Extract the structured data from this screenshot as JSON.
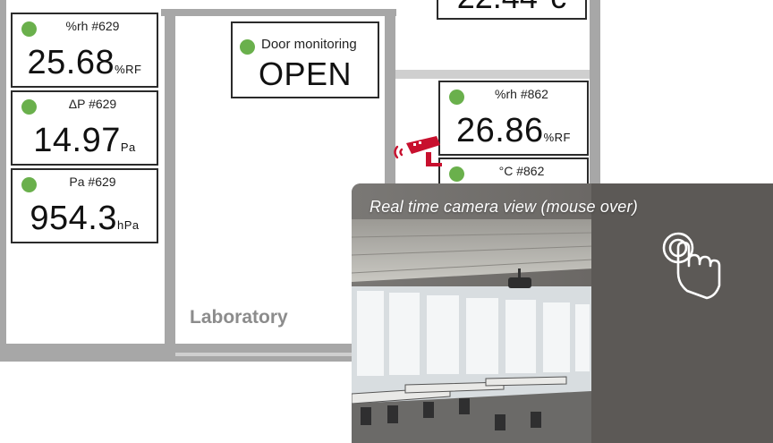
{
  "floorplan": {
    "room_label": "Laboratory"
  },
  "widgets": {
    "rh629": {
      "title": "%rh #629",
      "value": "25.68",
      "unit": "%RF",
      "status_color": "#6ab04c"
    },
    "dp629": {
      "title": "ΔP #629",
      "value": "14.97",
      "unit": "Pa",
      "status_color": "#6ab04c"
    },
    "pa629": {
      "title": "Pa #629",
      "value": "954.3",
      "unit": "hPa",
      "status_color": "#6ab04c"
    },
    "door": {
      "title": "Door monitoring",
      "value": "OPEN",
      "status_color": "#6ab04c"
    },
    "rh862": {
      "title": "%rh #862",
      "value": "26.86",
      "unit": "%RF",
      "status_color": "#6ab04c"
    },
    "c862": {
      "title": "°C #862",
      "status_color": "#6ab04c"
    }
  },
  "camera": {
    "caption": "Real time camera view (mouse over)",
    "camera_icon": "security-camera-icon",
    "touch_icon": "touch-hand-icon",
    "accent_color": "#c8102e"
  }
}
